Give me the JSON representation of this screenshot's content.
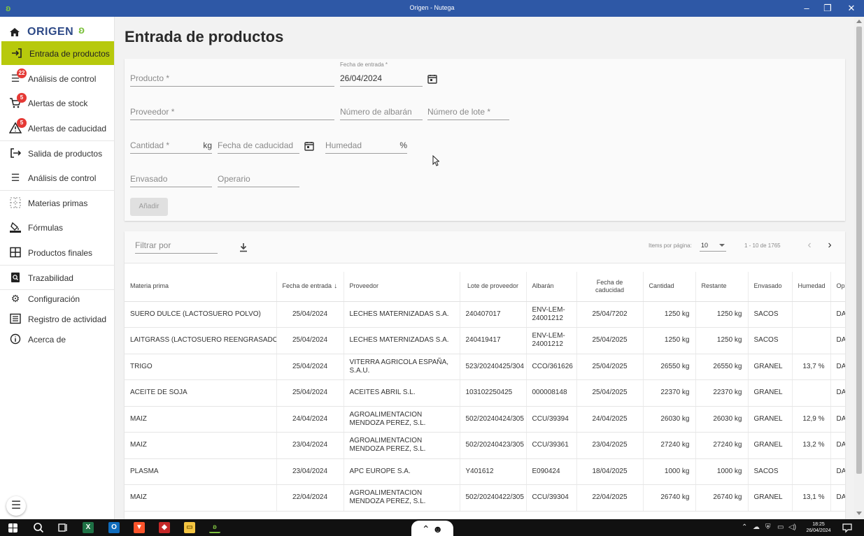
{
  "window": {
    "title": "Origen - Nutega",
    "minimize": "–",
    "maximize": "❐",
    "close": "✕"
  },
  "logo": {
    "text": "ORIGEN"
  },
  "sidebar": {
    "items": [
      {
        "label": "Entrada de productos",
        "icon": "login-icon",
        "active": true
      },
      {
        "label": "Análisis de control",
        "icon": "list-icon",
        "badge": "22"
      },
      {
        "label": "Alertas de stock",
        "icon": "cart-icon",
        "badge": "5"
      },
      {
        "label": "Alertas de caducidad",
        "icon": "warning-icon",
        "badge": "5"
      },
      {
        "label": "Salida de productos",
        "icon": "logout-icon"
      },
      {
        "label": "Análisis de control",
        "icon": "list-icon"
      },
      {
        "label": "Materias primas",
        "icon": "grid-dots-icon"
      },
      {
        "label": "Fórmulas",
        "icon": "format-color-icon"
      },
      {
        "label": "Productos finales",
        "icon": "table-icon"
      },
      {
        "label": "Trazabilidad",
        "icon": "search-doc-icon"
      },
      {
        "label": "Configuración",
        "icon": "gear-icon"
      },
      {
        "label": "Registro de actividad",
        "icon": "register-icon"
      },
      {
        "label": "Acerca de",
        "icon": "info-icon"
      }
    ]
  },
  "page": {
    "title": "Entrada de productos"
  },
  "form": {
    "producto": "Producto *",
    "fecha_entrada_label": "Fecha de entrada *",
    "fecha_entrada_value": "26/04/2024",
    "proveedor": "Proveedor *",
    "albaran": "Número de albarán",
    "lote": "Número de lote *",
    "cantidad": "Cantidad *",
    "cantidad_unit": "kg",
    "caducidad": "Fecha de caducidad",
    "humedad": "Humedad",
    "humedad_unit": "%",
    "envasado": "Envasado",
    "operario": "Operario",
    "add_label": "Añadir"
  },
  "toolbar": {
    "filter_placeholder": "Filtrar por",
    "items_per_page_label": "Items por página:",
    "items_per_page_value": "10",
    "range": "1 - 10 de 1765",
    "prev": "‹",
    "next": "›"
  },
  "table": {
    "headers": [
      "Materia prima",
      "Fecha de entrada",
      "Proveedor",
      "Lote de proveedor",
      "Albarán",
      "Fecha de caducidad",
      "Cantidad",
      "Restante",
      "Envasado",
      "Humedad",
      "Op"
    ],
    "sort_indicator": "↓",
    "rows": [
      [
        "SUERO DULCE (LACTOSUERO POLVO)",
        "25/04/2024",
        "LECHES MATERNIZADAS S.A.",
        "240407017",
        "ENV-LEM-24001212",
        "25/04/7202",
        "1250 kg",
        "1250 kg",
        "SACOS",
        "",
        "DA"
      ],
      [
        "LAITGRASS (LACTOSUERO REENGRASADO)",
        "25/04/2024",
        "LECHES MATERNIZADAS S.A.",
        "240419417",
        "ENV-LEM-24001212",
        "25/04/2025",
        "1250 kg",
        "1250 kg",
        "SACOS",
        "",
        "DA"
      ],
      [
        "TRIGO",
        "25/04/2024",
        "VITERRA AGRICOLA ESPAÑA, S.A.U.",
        "523/20240425/304",
        "CCO/361626",
        "25/04/2025",
        "26550 kg",
        "26550 kg",
        "GRANEL",
        "13,7 %",
        "DA"
      ],
      [
        "ACEITE DE SOJA",
        "25/04/2024",
        "ACEITES ABRIL S.L.",
        "103102250425",
        "000008148",
        "25/04/2025",
        "22370 kg",
        "22370 kg",
        "GRANEL",
        "",
        "DA"
      ],
      [
        "MAIZ",
        "24/04/2024",
        "AGROALIMENTACION MENDOZA PEREZ, S.L.",
        "502/20240424/305",
        "CCU/39394",
        "24/04/2025",
        "26030 kg",
        "26030 kg",
        "GRANEL",
        "12,9 %",
        "DA"
      ],
      [
        "MAIZ",
        "23/04/2024",
        "AGROALIMENTACION MENDOZA PEREZ, S.L.",
        "502/20240423/305",
        "CCU/39361",
        "23/04/2025",
        "27240 kg",
        "27240 kg",
        "GRANEL",
        "13,2 %",
        "DA"
      ],
      [
        "PLASMA",
        "23/04/2024",
        "APC EUROPE S.A.",
        "Y401612",
        "E090424",
        "18/04/2025",
        "1000 kg",
        "1000 kg",
        "SACOS",
        "",
        "DA"
      ],
      [
        "MAIZ",
        "22/04/2024",
        "AGROALIMENTACION MENDOZA PEREZ, S.L.",
        "502/20240422/305",
        "CCU/39304",
        "22/04/2025",
        "26740 kg",
        "26740 kg",
        "GRANEL",
        "13,1 %",
        "DA"
      ]
    ]
  },
  "taskbar": {
    "clock_time": "18:25",
    "clock_date": "26/04/2024"
  },
  "colors": {
    "titlebar": "#2e58a6",
    "active_nav": "#b7c90c",
    "badge": "#e53935",
    "brand_blue": "#2e4a87",
    "brand_green": "#7fc241"
  }
}
